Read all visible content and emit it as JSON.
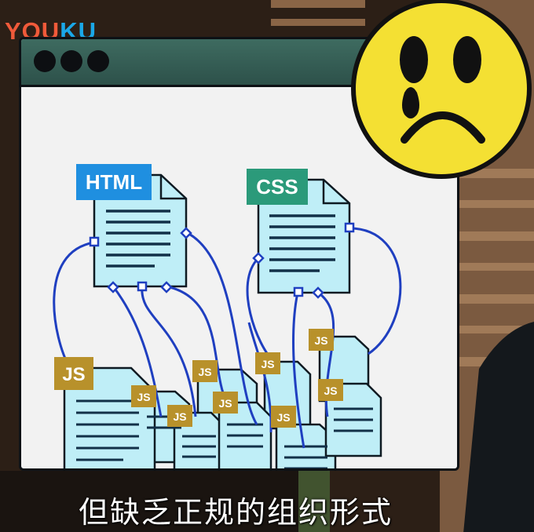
{
  "logo": {
    "part1": "YOU",
    "part2": "KU"
  },
  "diagram": {
    "html_label": "HTML",
    "css_label": "CSS",
    "js_label": "JS"
  },
  "subtitle": "但缺乏正规的组织形式",
  "colors": {
    "html_badge": "#1f8fe0",
    "css_badge": "#2b9a7a",
    "js_badge": "#b8912b",
    "doc_fill": "#bfeef7",
    "line": "#1f3fc0"
  }
}
